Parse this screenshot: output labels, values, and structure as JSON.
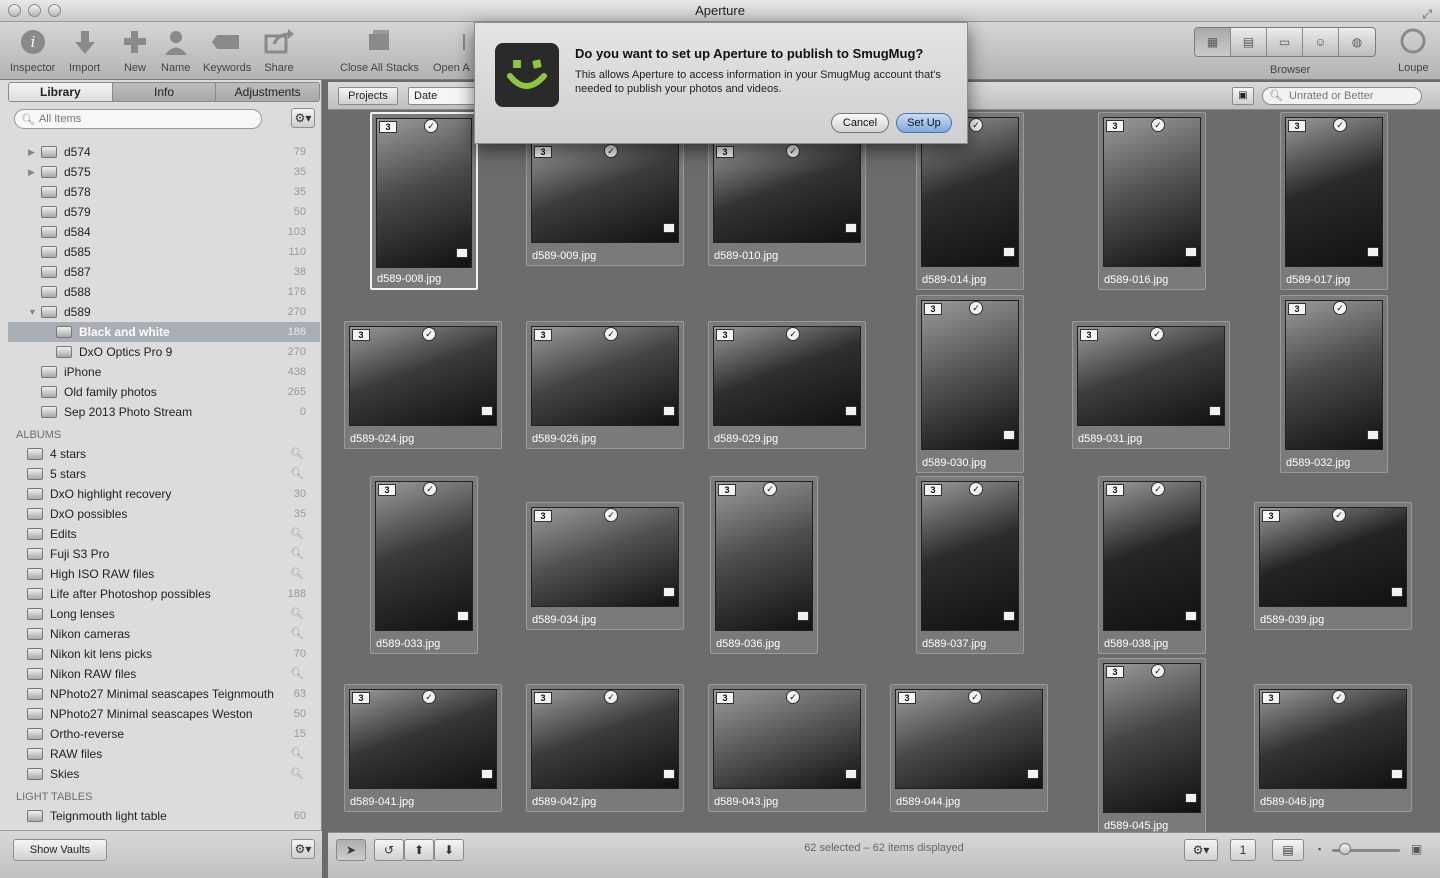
{
  "window": {
    "title": "Aperture"
  },
  "toolbar": {
    "left_buttons": [
      {
        "label": "Inspector",
        "icon": "info-icon"
      },
      {
        "label": "Import",
        "icon": "import-arrow-icon"
      },
      {
        "label": "New",
        "icon": "plus-icon"
      },
      {
        "label": "Name",
        "icon": "person-icon"
      },
      {
        "label": "Keywords",
        "icon": "tag-icon"
      },
      {
        "label": "Share",
        "icon": "share-icon"
      }
    ],
    "close_stacks": "Close All Stacks",
    "open_stacks": "Open A",
    "browser_label": "Browser",
    "loupe_label": "Loupe"
  },
  "library": {
    "tabs": [
      "Library",
      "Info",
      "Adjustments"
    ],
    "search_placeholder": "All Items",
    "projects": [
      {
        "name": "d574",
        "count": "79",
        "disclosure": "▶"
      },
      {
        "name": "d575",
        "count": "35",
        "disclosure": "▶"
      },
      {
        "name": "d578",
        "count": "35",
        "disclosure": ""
      },
      {
        "name": "d579",
        "count": "50",
        "disclosure": ""
      },
      {
        "name": "d584",
        "count": "103",
        "disclosure": ""
      },
      {
        "name": "d585",
        "count": "110",
        "disclosure": ""
      },
      {
        "name": "d587",
        "count": "38",
        "disclosure": ""
      },
      {
        "name": "d588",
        "count": "176",
        "disclosure": ""
      },
      {
        "name": "d589",
        "count": "270",
        "disclosure": "▼"
      }
    ],
    "subitems": [
      {
        "name": "Black and white",
        "count": "186",
        "selected": true
      },
      {
        "name": "DxO Optics Pro 9",
        "count": "270",
        "selected": false
      }
    ],
    "more_projects": [
      {
        "name": "iPhone",
        "count": "438"
      },
      {
        "name": "Old family photos",
        "count": "265"
      },
      {
        "name": "Sep 2013 Photo Stream",
        "count": "0"
      }
    ],
    "albums_header": "ALBUMS",
    "albums": [
      {
        "name": "4 stars",
        "count": ""
      },
      {
        "name": "5 stars",
        "count": ""
      },
      {
        "name": "DxO highlight recovery",
        "count": "30"
      },
      {
        "name": "DxO possibles",
        "count": "35"
      },
      {
        "name": "Edits",
        "count": ""
      },
      {
        "name": "Fuji S3 Pro",
        "count": ""
      },
      {
        "name": "High ISO RAW files",
        "count": ""
      },
      {
        "name": "Life after Photoshop possibles",
        "count": "188"
      },
      {
        "name": "Long lenses",
        "count": ""
      },
      {
        "name": "Nikon cameras",
        "count": ""
      },
      {
        "name": "Nikon kit lens picks",
        "count": "70"
      },
      {
        "name": "Nikon RAW files",
        "count": ""
      },
      {
        "name": "NPhoto27 Minimal seascapes Teignmouth",
        "count": "63"
      },
      {
        "name": "NPhoto27 Minimal seascapes Weston",
        "count": "50"
      },
      {
        "name": "Ortho-reverse",
        "count": "15"
      },
      {
        "name": "RAW files",
        "count": ""
      },
      {
        "name": "Skies",
        "count": ""
      }
    ],
    "light_tables_header": "LIGHT TABLES",
    "light_tables": [
      {
        "name": "Teignmouth light table",
        "count": "60"
      }
    ],
    "show_vaults": "Show Vaults"
  },
  "browser": {
    "projects_button": "Projects",
    "sort_field": "Date",
    "rating_filter": "Unrated or Better",
    "status": "62 selected – 62 items displayed"
  },
  "photos": [
    {
      "name": "d589-008.jpg",
      "stack": "3",
      "orient": "portrait",
      "tone": "#4a4a4a"
    },
    {
      "name": "d589-009.jpg",
      "stack": "3",
      "orient": "landscape",
      "tone": "#3c3c3c"
    },
    {
      "name": "d589-010.jpg",
      "stack": "3",
      "orient": "landscape",
      "tone": "#333333"
    },
    {
      "name": "d589-014.jpg",
      "stack": "",
      "orient": "portrait",
      "tone": "#2e2e2e"
    },
    {
      "name": "d589-016.jpg",
      "stack": "3",
      "orient": "portrait",
      "tone": "#555555"
    },
    {
      "name": "d589-017.jpg",
      "stack": "3",
      "orient": "portrait",
      "tone": "#2a2a2a"
    },
    {
      "name": "d589-024.jpg",
      "stack": "3",
      "orient": "landscape",
      "tone": "#3a3a3a"
    },
    {
      "name": "d589-026.jpg",
      "stack": "3",
      "orient": "landscape",
      "tone": "#444444"
    },
    {
      "name": "d589-029.jpg",
      "stack": "3",
      "orient": "landscape",
      "tone": "#2f2f2f"
    },
    {
      "name": "d589-030.jpg",
      "stack": "3",
      "orient": "portrait",
      "tone": "#575757"
    },
    {
      "name": "d589-031.jpg",
      "stack": "3",
      "orient": "landscape",
      "tone": "#3d3d3d"
    },
    {
      "name": "d589-032.jpg",
      "stack": "3",
      "orient": "portrait",
      "tone": "#4b4b4b"
    },
    {
      "name": "d589-033.jpg",
      "stack": "3",
      "orient": "portrait",
      "tone": "#3a3a3a"
    },
    {
      "name": "d589-034.jpg",
      "stack": "3",
      "orient": "landscape",
      "tone": "#505050"
    },
    {
      "name": "d589-036.jpg",
      "stack": "3",
      "orient": "portrait",
      "tone": "#4e4e4e"
    },
    {
      "name": "d589-037.jpg",
      "stack": "3",
      "orient": "portrait",
      "tone": "#2c2c2c"
    },
    {
      "name": "d589-038.jpg",
      "stack": "3",
      "orient": "portrait",
      "tone": "#262626"
    },
    {
      "name": "d589-039.jpg",
      "stack": "3",
      "orient": "landscape",
      "tone": "#242424"
    },
    {
      "name": "d589-041.jpg",
      "stack": "3",
      "orient": "landscape",
      "tone": "#353535"
    },
    {
      "name": "d589-042.jpg",
      "stack": "3",
      "orient": "landscape",
      "tone": "#3b3b3b"
    },
    {
      "name": "d589-043.jpg",
      "stack": "3",
      "orient": "landscape",
      "tone": "#5a5a5a"
    },
    {
      "name": "d589-044.jpg",
      "stack": "3",
      "orient": "landscape",
      "tone": "#4a4a4a"
    },
    {
      "name": "d589-045.jpg",
      "stack": "3",
      "orient": "portrait",
      "tone": "#454545"
    },
    {
      "name": "d589-046.jpg",
      "stack": "3",
      "orient": "landscape",
      "tone": "#333333"
    }
  ],
  "dialog": {
    "title": "Do you want to set up Aperture to publish to SmugMug?",
    "body": "This allows Aperture to access information in your SmugMug account that's needed to publish your photos and videos.",
    "cancel": "Cancel",
    "setup": "Set Up",
    "icon": "smugmug-logo-icon",
    "accent": "#8dc63f"
  }
}
